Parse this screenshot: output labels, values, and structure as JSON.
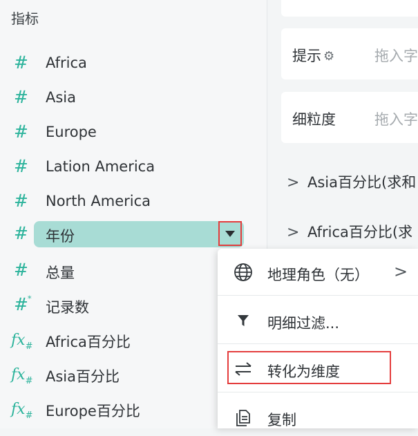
{
  "panel": {
    "title": "指标"
  },
  "fields": [
    {
      "icon": "measure-hash-icon",
      "glyph": "#",
      "label": "Africa"
    },
    {
      "icon": "measure-hash-icon",
      "glyph": "#",
      "label": "Asia"
    },
    {
      "icon": "measure-hash-icon",
      "glyph": "#",
      "label": "Europe"
    },
    {
      "icon": "measure-hash-icon",
      "glyph": "#",
      "label": "Lation America"
    },
    {
      "icon": "measure-hash-icon",
      "glyph": "#",
      "label": "North America"
    },
    {
      "icon": "measure-hash-icon",
      "glyph": "#",
      "label": "年份",
      "selected": true
    },
    {
      "icon": "measure-hash-icon",
      "glyph": "#",
      "label": "总量"
    },
    {
      "icon": "record-count-icon",
      "glyph": "#",
      "label": "记录数"
    },
    {
      "icon": "calculated-field-icon",
      "glyph": "fx",
      "label": "Africa百分比"
    },
    {
      "icon": "calculated-field-icon",
      "glyph": "fx",
      "label": "Asia百分比"
    },
    {
      "icon": "calculated-field-icon",
      "glyph": "fx",
      "label": "Europe百分比"
    }
  ],
  "shelves": {
    "tooltip": {
      "label": "提示",
      "placeholder": "拖入字"
    },
    "detail": {
      "label": "细粒度",
      "placeholder": "拖入字"
    }
  },
  "measures": [
    {
      "label": "Asia百分比(求和"
    },
    {
      "label": "Africa百分比(求"
    }
  ],
  "context_menu": {
    "items": [
      {
        "icon": "globe-icon",
        "label": "地理角色（无）",
        "has_submenu": true
      },
      {
        "icon": "filter-icon",
        "label": "明细过滤..."
      },
      {
        "icon": "convert-icon",
        "label": "转化为维度",
        "highlighted": true
      },
      {
        "icon": "copy-icon",
        "label": "复制"
      }
    ]
  },
  "colors": {
    "accent": "#2bb39b",
    "selected_bg": "#a8dcd5",
    "highlight": "#e43c3c"
  }
}
